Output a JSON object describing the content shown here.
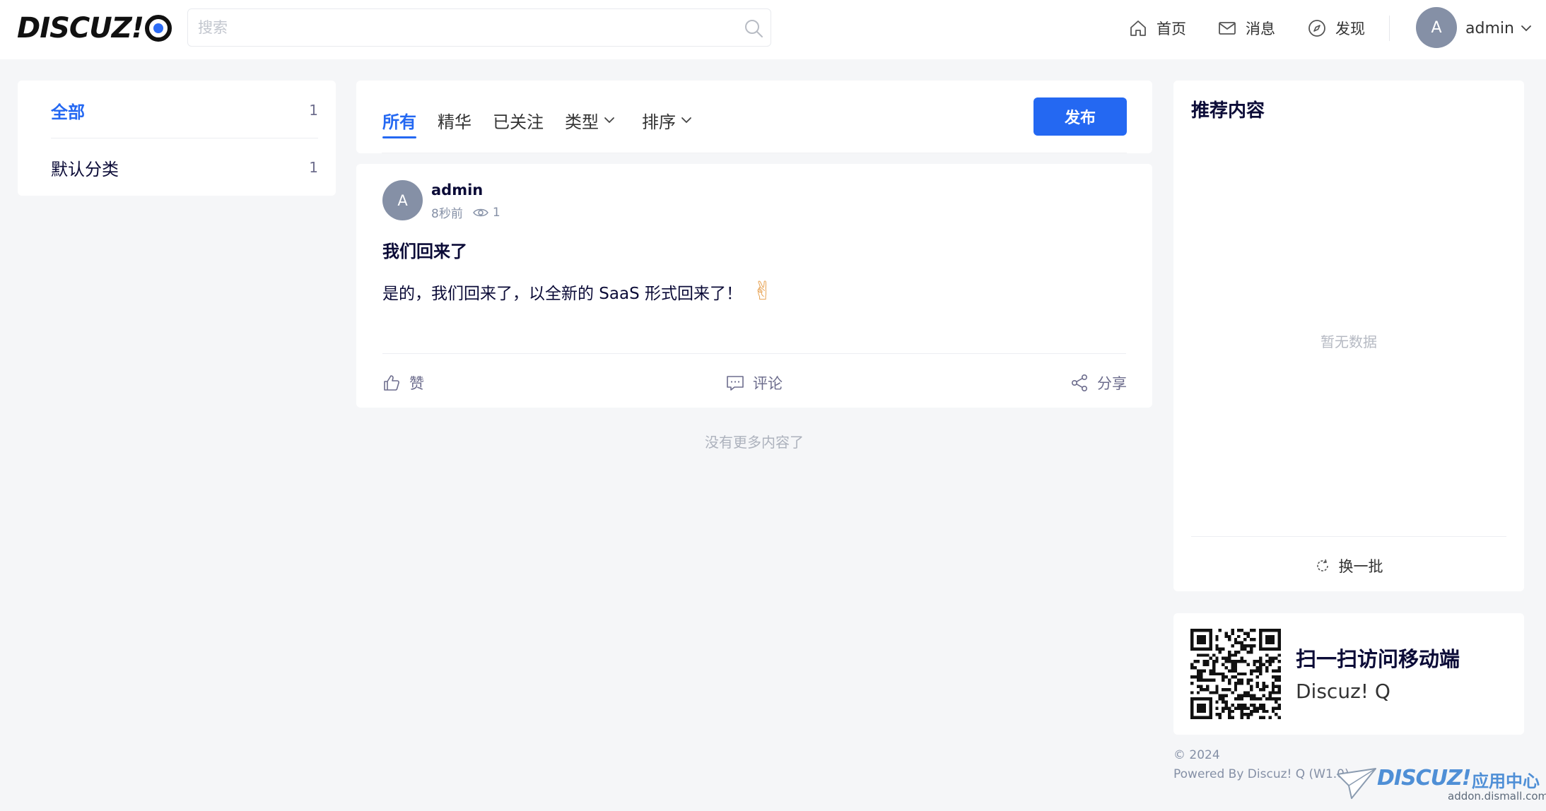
{
  "header": {
    "logo_text": "DISCUZ!",
    "search_placeholder": "搜索",
    "nav": [
      {
        "label": "首页",
        "icon": "home-icon"
      },
      {
        "label": "消息",
        "icon": "mail-icon"
      },
      {
        "label": "发现",
        "icon": "compass-icon"
      }
    ],
    "user": {
      "avatar_letter": "A",
      "name": "admin"
    }
  },
  "categories": [
    {
      "label": "全部",
      "count": "1",
      "active": true
    },
    {
      "label": "默认分类",
      "count": "1",
      "active": false
    }
  ],
  "tabs": [
    {
      "label": "所有",
      "active": true
    },
    {
      "label": "精华"
    },
    {
      "label": "已关注"
    },
    {
      "label": "类型",
      "dropdown": true
    },
    {
      "label": "排序",
      "dropdown": true
    }
  ],
  "publish_label": "发布",
  "post": {
    "avatar_letter": "A",
    "author": "admin",
    "time": "8秒前",
    "views": "1",
    "title": "我们回来了",
    "body": "是的，我们回来了，以全新的 SaaS 形式回来了！",
    "emoji": "✌",
    "actions": {
      "like": "赞",
      "comment": "评论",
      "share": "分享"
    }
  },
  "no_more": "没有更多内容了",
  "recommend": {
    "title": "推荐内容",
    "empty": "暂无数据",
    "refresh": "换一批"
  },
  "qr": {
    "title": "扫一扫访问移动端",
    "subtitle": "Discuz! Q"
  },
  "footer": {
    "copyright": "© 2024",
    "powered": "Powered By Discuz! Q (W1.0)"
  },
  "watermark": {
    "brand": "DISCUZ!",
    "cn": "应用中心",
    "url": "addon.dismall.com"
  },
  "colors": {
    "accent": "#2468f2",
    "background": "#f5f6f8",
    "avatar": "#8590a6"
  }
}
